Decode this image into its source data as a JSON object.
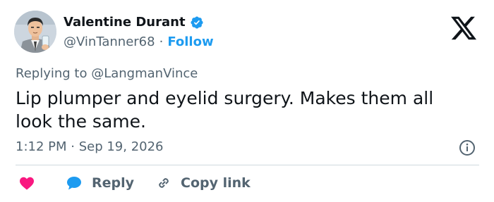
{
  "author": {
    "display_name": "Valentine Durant",
    "handle": "@VinTanner68",
    "separator": "·",
    "follow_label": "Follow",
    "verified_color": "#1d9bf0"
  },
  "reply_context": {
    "prefix": "Replying to",
    "mention": "@LangmanVince"
  },
  "tweet": {
    "text": "Lip plumper and eyelid surgery. Makes them all look the same.",
    "timestamp": "1:12 PM · Sep 19, 2026"
  },
  "actions": {
    "reply_label": "Reply",
    "copy_link_label": "Copy link"
  },
  "icons": {
    "avatar": "avatar-cartoon-man",
    "verified": "verified-badge-icon",
    "logo": "x-logo-icon",
    "info": "info-icon",
    "like": "heart-icon",
    "reply": "speech-bubble-icon",
    "copy_link": "link-icon"
  },
  "colors": {
    "heart": "#f91880",
    "reply_bubble": "#1d9bf0",
    "link_blue": "#1d9bf0",
    "muted_text": "#536471"
  }
}
